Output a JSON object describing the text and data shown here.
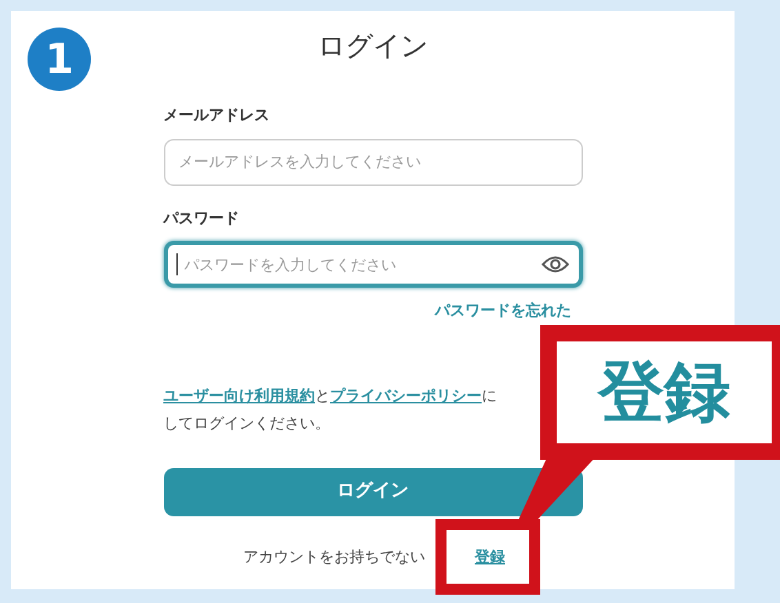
{
  "step_badge": "1",
  "title": "ログイン",
  "fields": [
    {
      "label": "メールアドレス",
      "placeholder": "メールアドレスを入力してください",
      "focused": false,
      "kind": "text"
    },
    {
      "label": "パスワード",
      "placeholder": "パスワードを入力してください",
      "focused": true,
      "kind": "password"
    }
  ],
  "forgot_link": "パスワードを忘れた",
  "terms": {
    "link_1": "ユーザー向け利用規約",
    "joiner": "と",
    "link_2": "プライバシーポリシー",
    "tail": "に",
    "line_2": "してログインください。"
  },
  "login_button": "ログイン",
  "signup": {
    "prompt": "アカウントをお持ちでない",
    "link": "登録"
  },
  "callout": {
    "text": "登録"
  }
}
